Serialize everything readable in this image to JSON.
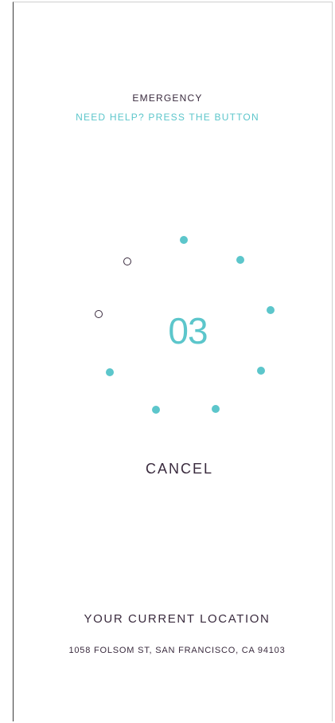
{
  "header": {
    "title": "EMERGENCY",
    "subtitle": "NEED HELP? PRESS THE BUTTON"
  },
  "countdown": {
    "value": "03",
    "dots_total": 9,
    "dots_filled": 7,
    "accent_color": "#5cc6cb",
    "empty_color": "#3a2b3e"
  },
  "cancel": {
    "label": "CANCEL"
  },
  "location": {
    "title": "YOUR CURRENT LOCATION",
    "address": "1058 FOLSOM ST, SAN FRANCISCO, CA 94103"
  }
}
